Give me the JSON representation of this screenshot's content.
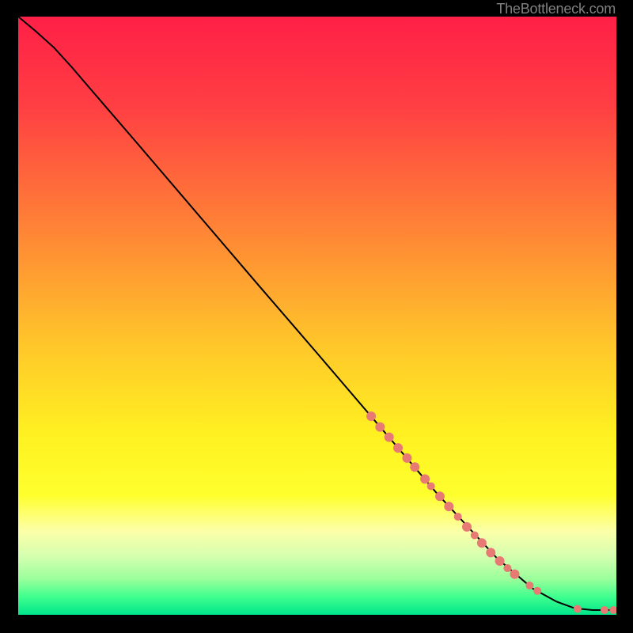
{
  "attribution": "TheBottleneck.com",
  "chart_data": {
    "type": "line",
    "title": "",
    "xlabel": "",
    "ylabel": "",
    "xlim": [
      0,
      100
    ],
    "ylim": [
      0,
      100
    ],
    "background_gradient": {
      "stops": [
        {
          "pct": 0,
          "color": "#ff1f47"
        },
        {
          "pct": 15,
          "color": "#ff3f43"
        },
        {
          "pct": 35,
          "color": "#ff8236"
        },
        {
          "pct": 55,
          "color": "#ffc72a"
        },
        {
          "pct": 70,
          "color": "#fff121"
        },
        {
          "pct": 80,
          "color": "#ffff2e"
        },
        {
          "pct": 86,
          "color": "#fcffa8"
        },
        {
          "pct": 90,
          "color": "#d7ffb0"
        },
        {
          "pct": 94,
          "color": "#9bff9b"
        },
        {
          "pct": 97,
          "color": "#3fff8f"
        },
        {
          "pct": 100,
          "color": "#00e58a"
        }
      ]
    },
    "curve": [
      {
        "x": 0,
        "y": 100
      },
      {
        "x": 3,
        "y": 97.5
      },
      {
        "x": 6,
        "y": 94.8
      },
      {
        "x": 9,
        "y": 91.5
      },
      {
        "x": 12,
        "y": 88
      },
      {
        "x": 20,
        "y": 78.7
      },
      {
        "x": 30,
        "y": 67
      },
      {
        "x": 40,
        "y": 55.3
      },
      {
        "x": 50,
        "y": 43.7
      },
      {
        "x": 60,
        "y": 32
      },
      {
        "x": 70,
        "y": 20.3
      },
      {
        "x": 80,
        "y": 9.5
      },
      {
        "x": 86,
        "y": 4.4
      },
      {
        "x": 90,
        "y": 2.2
      },
      {
        "x": 93,
        "y": 1.1
      },
      {
        "x": 96,
        "y": 0.8
      },
      {
        "x": 100,
        "y": 0.8
      }
    ],
    "curve_color": "#000000",
    "markers": [
      {
        "x": 59,
        "y": 33.2,
        "r": 6,
        "color": "#e77a73"
      },
      {
        "x": 60.5,
        "y": 31.4,
        "r": 6,
        "color": "#e77a73"
      },
      {
        "x": 62,
        "y": 29.7,
        "r": 6,
        "color": "#e77a73"
      },
      {
        "x": 63.5,
        "y": 27.9,
        "r": 6,
        "color": "#e77a73"
      },
      {
        "x": 65,
        "y": 26.2,
        "r": 6,
        "color": "#e77a73"
      },
      {
        "x": 66.3,
        "y": 24.7,
        "r": 6,
        "color": "#e77a73"
      },
      {
        "x": 68,
        "y": 22.7,
        "r": 6,
        "color": "#e77a73"
      },
      {
        "x": 69,
        "y": 21.5,
        "r": 5,
        "color": "#e77a73"
      },
      {
        "x": 70.5,
        "y": 19.8,
        "r": 6,
        "color": "#e77a73"
      },
      {
        "x": 72,
        "y": 18.1,
        "r": 6,
        "color": "#e77a73"
      },
      {
        "x": 73.5,
        "y": 16.4,
        "r": 5,
        "color": "#e77a73"
      },
      {
        "x": 75,
        "y": 14.7,
        "r": 6,
        "color": "#e77a73"
      },
      {
        "x": 76.3,
        "y": 13.3,
        "r": 5,
        "color": "#e77a73"
      },
      {
        "x": 77.5,
        "y": 12.0,
        "r": 6,
        "color": "#e77a73"
      },
      {
        "x": 79,
        "y": 10.4,
        "r": 6,
        "color": "#e77a73"
      },
      {
        "x": 80.5,
        "y": 9.0,
        "r": 6,
        "color": "#e77a73"
      },
      {
        "x": 81.8,
        "y": 7.8,
        "r": 5,
        "color": "#e77a73"
      },
      {
        "x": 83,
        "y": 6.8,
        "r": 6,
        "color": "#e77a73"
      },
      {
        "x": 85.5,
        "y": 4.9,
        "r": 5,
        "color": "#e77a73"
      },
      {
        "x": 86.8,
        "y": 4.0,
        "r": 5,
        "color": "#e77a73"
      },
      {
        "x": 93.5,
        "y": 1.0,
        "r": 5,
        "color": "#e77a73"
      },
      {
        "x": 98,
        "y": 0.8,
        "r": 5,
        "color": "#e77a73"
      },
      {
        "x": 99.5,
        "y": 0.8,
        "r": 5,
        "color": "#e77a73"
      }
    ]
  }
}
